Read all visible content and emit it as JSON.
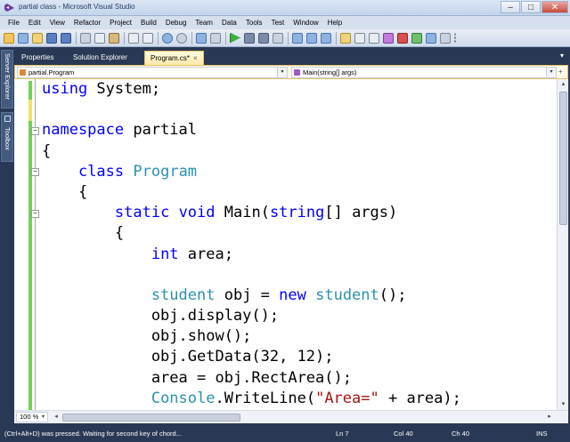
{
  "window": {
    "title": "partial class - Microsoft Visual Studio",
    "controls": [
      "–",
      "□",
      "✕"
    ]
  },
  "menu": [
    "File",
    "Edit",
    "View",
    "Refactor",
    "Project",
    "Build",
    "Debug",
    "Team",
    "Data",
    "Tools",
    "Test",
    "Window",
    "Help"
  ],
  "side_tabs": {
    "server_explorer": "Server Explorer",
    "toolbox": "Toolbox"
  },
  "doc_tabs": {
    "properties": "Properties",
    "solution_explorer": "Solution Explorer",
    "program_cs": "Program.cs*",
    "close_glyph": "×",
    "dropdown_glyph": "▾"
  },
  "nav": {
    "class_combo": "partial.Program",
    "member_combo": "Main(string[] args)",
    "arrow": "▾",
    "split_glyph": "+"
  },
  "code": {
    "fold_collapse": "−",
    "lines": [
      [
        {
          "t": "using",
          "c": "kw"
        },
        {
          "t": " System;",
          "c": ""
        }
      ],
      [
        {
          "t": "",
          "c": ""
        }
      ],
      [
        {
          "t": "namespace",
          "c": "kw"
        },
        {
          "t": " partial",
          "c": ""
        }
      ],
      [
        {
          "t": "{",
          "c": ""
        }
      ],
      [
        {
          "t": "    ",
          "c": ""
        },
        {
          "t": "class",
          "c": "kw"
        },
        {
          "t": " ",
          "c": ""
        },
        {
          "t": "Program",
          "c": "ty"
        }
      ],
      [
        {
          "t": "    {",
          "c": ""
        }
      ],
      [
        {
          "t": "        ",
          "c": ""
        },
        {
          "t": "static",
          "c": "kw"
        },
        {
          "t": " ",
          "c": ""
        },
        {
          "t": "void",
          "c": "kw"
        },
        {
          "t": " Main(",
          "c": ""
        },
        {
          "t": "string",
          "c": "kw"
        },
        {
          "t": "[] args)",
          "c": ""
        }
      ],
      [
        {
          "t": "        {",
          "c": ""
        }
      ],
      [
        {
          "t": "            ",
          "c": ""
        },
        {
          "t": "int",
          "c": "kw"
        },
        {
          "t": " area;",
          "c": ""
        }
      ],
      [
        {
          "t": "",
          "c": ""
        }
      ],
      [
        {
          "t": "            ",
          "c": ""
        },
        {
          "t": "student",
          "c": "ty"
        },
        {
          "t": " obj = ",
          "c": ""
        },
        {
          "t": "new",
          "c": "kw"
        },
        {
          "t": " ",
          "c": ""
        },
        {
          "t": "student",
          "c": "ty"
        },
        {
          "t": "();",
          "c": ""
        }
      ],
      [
        {
          "t": "            obj.display();",
          "c": ""
        }
      ],
      [
        {
          "t": "            obj.show();",
          "c": ""
        }
      ],
      [
        {
          "t": "            obj.GetData(32, 12);",
          "c": ""
        }
      ],
      [
        {
          "t": "            area = obj.RectArea();",
          "c": ""
        }
      ],
      [
        {
          "t": "            ",
          "c": ""
        },
        {
          "t": "Console",
          "c": "ty"
        },
        {
          "t": ".WriteLine(",
          "c": ""
        },
        {
          "t": "\"Area=\"",
          "c": "str"
        },
        {
          "t": " + area);",
          "c": ""
        }
      ]
    ]
  },
  "hbar": {
    "zoom": "100 %",
    "zoom_arrow": "▾",
    "left_arrow": "◂",
    "right_arrow": "▸"
  },
  "vscroll": {
    "up_arrow": "▴",
    "down_arrow": "▾"
  },
  "status": {
    "message": "(Ctrl+Alt+D) was pressed. Waiting for second key of chord...",
    "line": "Ln 7",
    "col": "Col 40",
    "ch": "Ch 40",
    "mode": "INS"
  }
}
